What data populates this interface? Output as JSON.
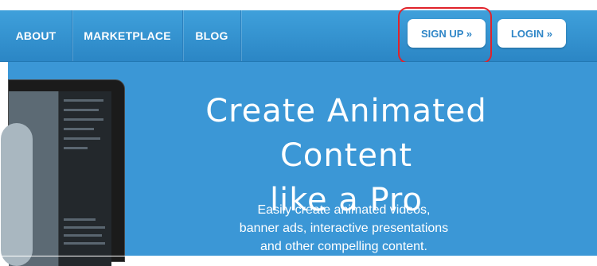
{
  "nav": {
    "items": [
      {
        "label": "ABOUT"
      },
      {
        "label": "MARKETPLACE"
      },
      {
        "label": "BLOG"
      }
    ],
    "signup_label": "SIGN UP »",
    "login_label": "LOGIN »"
  },
  "hero": {
    "headline_line1": "Create Animated Content",
    "headline_line2": "like a Pro",
    "sub_line1": "Easily create animated videos,",
    "sub_line2": "banner ads, interactive presentations",
    "sub_line3": "and other compelling content."
  },
  "colors": {
    "nav_blue": "#3495d6",
    "hero_blue": "#3b97d6",
    "button_text": "#2f86c7",
    "highlight_red": "#e0232b"
  }
}
